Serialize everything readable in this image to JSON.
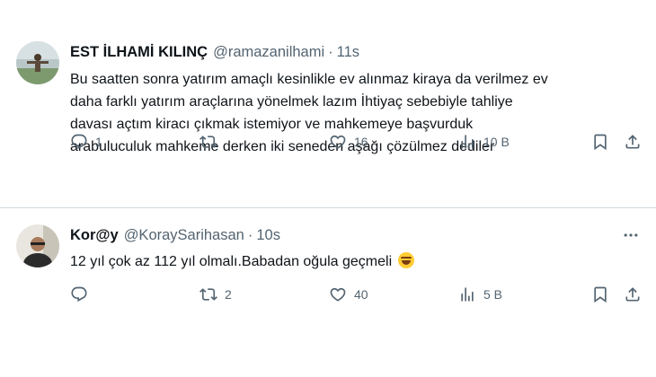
{
  "tweets": [
    {
      "name": "EST İLHAMİ KILINÇ",
      "handle": "@ramazanilhami",
      "separator": "·",
      "time": "11s",
      "text": "Bu saatten sonra yatırım amaçlı kesinlikle ev alınmaz kiraya da verilmez ev\ndaha farklı yatırım araçlarına yönelmek lazım İhtiyaç sebebiyle tahliye\ndavası açtım kiracı çıkmak istemiyor ve mahkemeye başvurduk\narabuluculuk mahkeme derken iki seneden aşağı çözülmez dediler",
      "reply_count": "1",
      "retweet_count": "",
      "like_count": "16",
      "view_count": "10 B"
    },
    {
      "name": "Kor@y",
      "handle": "@KoraySarihasan",
      "separator": "·",
      "time": "10s",
      "text": "12 yıl çok az 112 yıl olmalı.Babadan oğula geçmeli",
      "reply_count": "",
      "retweet_count": "2",
      "like_count": "40",
      "view_count": "5 B"
    }
  ],
  "colors": {
    "text_primary": "#0f1419",
    "text_secondary": "#536471",
    "divider": "#cfd9de"
  },
  "icons": [
    "reply-icon",
    "retweet-icon",
    "like-icon",
    "views-icon",
    "bookmark-icon",
    "share-icon",
    "more-icon",
    "rolling-laughing-emoji"
  ]
}
